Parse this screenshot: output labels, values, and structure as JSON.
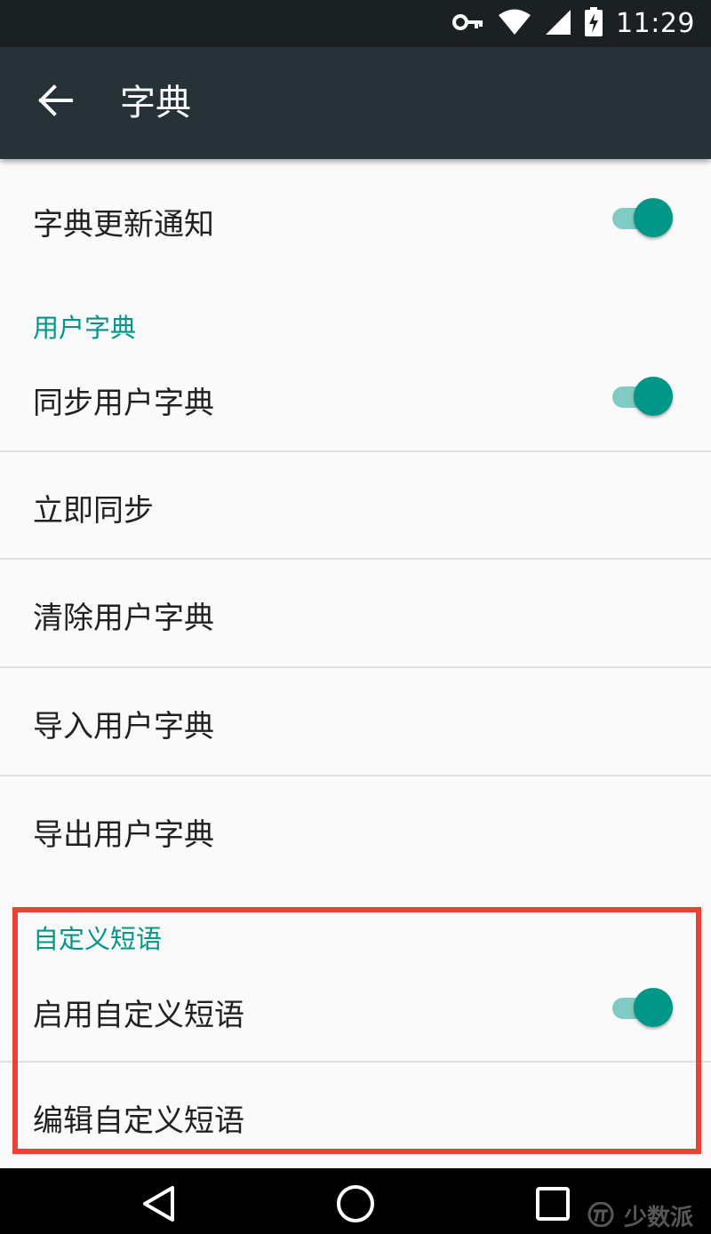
{
  "status_bar": {
    "time": "11:29",
    "icons": [
      "vpn-key-icon",
      "wifi-icon",
      "cell-signal-icon",
      "battery-charging-icon"
    ]
  },
  "toolbar": {
    "back_icon": "arrow-back-icon",
    "title": "字典"
  },
  "settings": {
    "dictionary_update_notification": {
      "label": "字典更新通知",
      "enabled": true
    },
    "user_dictionary": {
      "category": "用户字典",
      "sync": {
        "label": "同步用户字典",
        "enabled": true
      },
      "sync_now": "立即同步",
      "clear": "清除用户字典",
      "import": "导入用户字典",
      "export": "导出用户字典"
    },
    "custom_phrases": {
      "category": "自定义短语",
      "enable": {
        "label": "启用自定义短语",
        "enabled": true
      },
      "edit": "编辑自定义短语"
    }
  },
  "nav_bar": {
    "icons": [
      "back-triangle-icon",
      "home-circle-icon",
      "recents-square-icon"
    ]
  },
  "watermark": {
    "text": "少数派"
  },
  "colors": {
    "status_bar": "#1b2023",
    "toolbar": "#263238",
    "accent": "#009688",
    "switch_track": "#80cbc4",
    "highlight_border": "#ea4335",
    "background": "#fafafa"
  }
}
